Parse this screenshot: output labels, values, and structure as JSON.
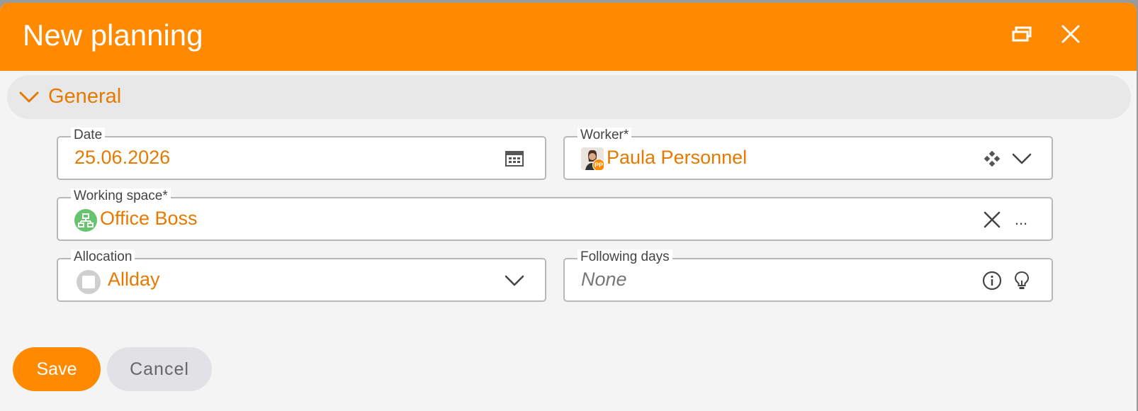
{
  "dialog": {
    "title": "New planning",
    "icons": {
      "restore": "restore-window-icon",
      "close": "close-icon"
    }
  },
  "section": {
    "label": "General",
    "icon": "chevron-down-icon"
  },
  "fields": {
    "date": {
      "label": "Date",
      "value": "25.06.2026",
      "icon": "calendar-icon"
    },
    "worker": {
      "label": "Worker*",
      "value": "Paula Personnel",
      "avatar_initials": "PP",
      "icons": [
        "drag-handle-icon",
        "chevron-down-icon"
      ]
    },
    "working_space": {
      "label": "Working space*",
      "value": "Office Boss",
      "icons": [
        "workspace-icon",
        "clear-icon",
        "more-icon"
      ],
      "more_text": "..."
    },
    "allocation": {
      "label": "Allocation",
      "value": "Allday",
      "icons": [
        "allday-icon",
        "chevron-down-icon"
      ]
    },
    "following_days": {
      "label": "Following days",
      "placeholder": "None",
      "icons": [
        "info-icon",
        "lightbulb-icon"
      ]
    }
  },
  "actions": {
    "save_label": "Save",
    "cancel_label": "Cancel"
  },
  "colors": {
    "header": "#ff8a00",
    "accent_text": "#e67a00",
    "workspace_icon": "#66c46e"
  }
}
